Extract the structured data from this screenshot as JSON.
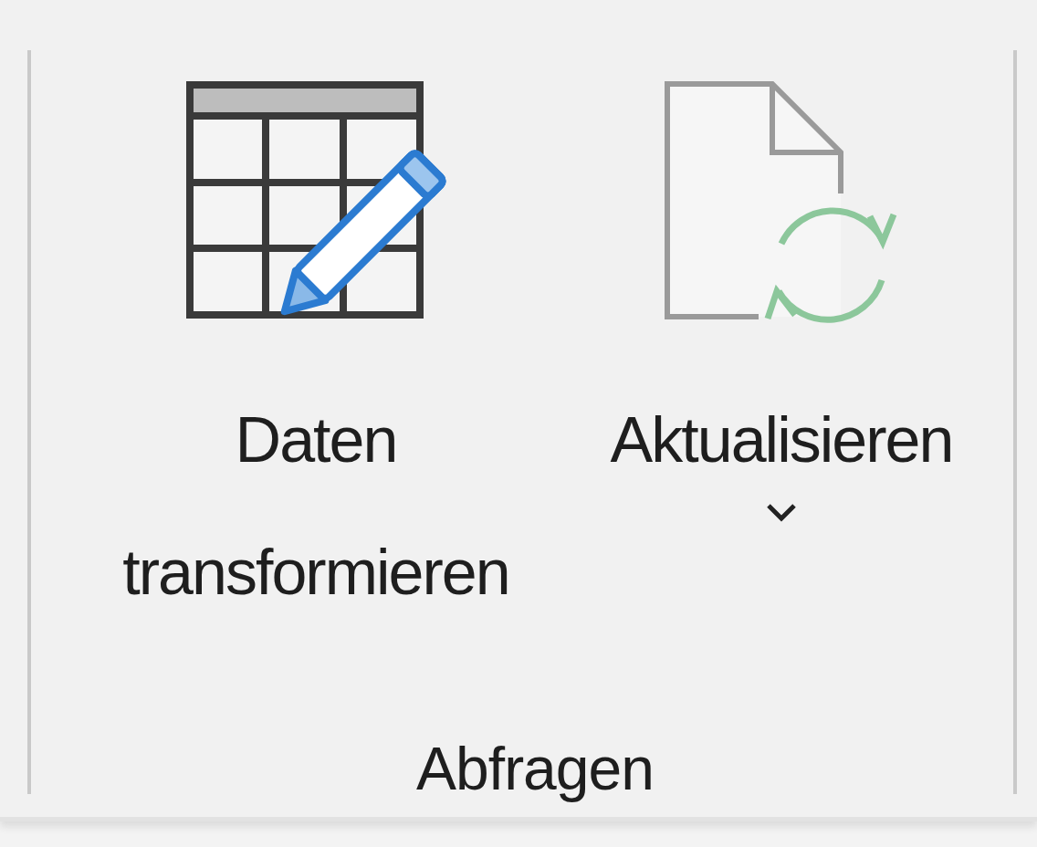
{
  "group": {
    "label": "Abfragen",
    "buttons": [
      {
        "kind": "transform",
        "label": "Daten transformieren",
        "has_dropdown": false
      },
      {
        "kind": "refresh",
        "label": "Aktualisieren",
        "has_dropdown": true
      }
    ]
  }
}
